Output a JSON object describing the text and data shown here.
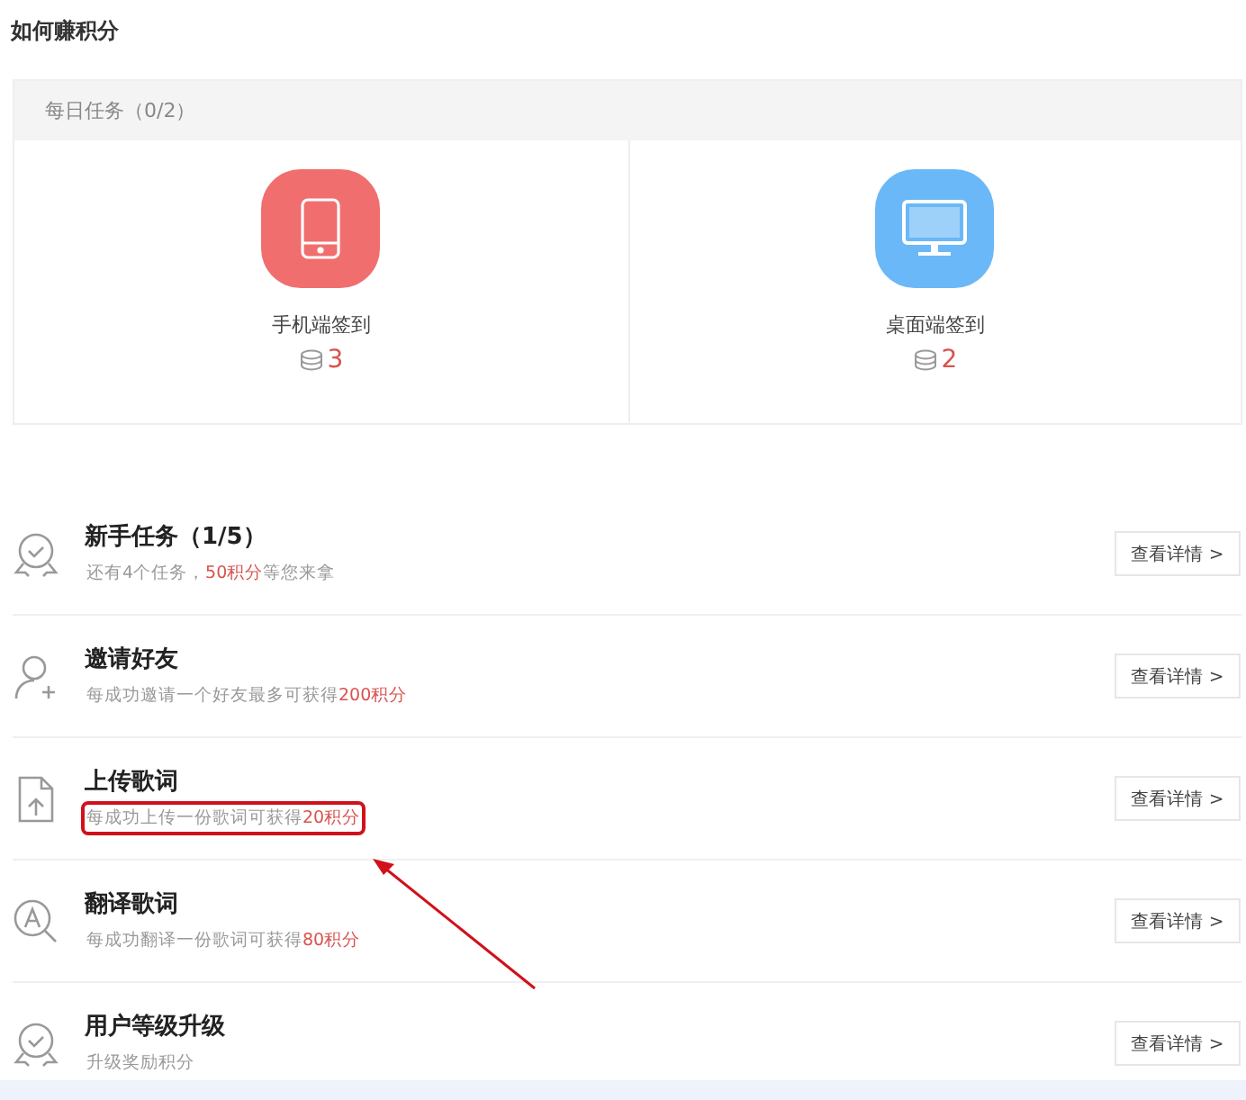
{
  "title": "如何赚积分",
  "daily": {
    "heading": "每日任务（0/2）",
    "tasks": [
      {
        "kind": "phone",
        "label": "手机端签到",
        "points": "3",
        "color": "#f16e6e"
      },
      {
        "kind": "desktop",
        "label": "桌面端签到",
        "points": "2",
        "color": "#6ab8f7"
      }
    ]
  },
  "tasks": [
    {
      "kind": "medal",
      "title": "新手任务（1/5）",
      "subtitle": [
        {
          "text": "还有4个任务，",
          "highlight": false
        },
        {
          "text": "50积分",
          "highlight": true
        },
        {
          "text": "等您来拿",
          "highlight": false
        }
      ],
      "button": "查看详情 >",
      "annotated": false
    },
    {
      "kind": "invite",
      "title": "邀请好友",
      "subtitle": [
        {
          "text": "每成功邀请一个好友最多可获得",
          "highlight": false
        },
        {
          "text": "200积分",
          "highlight": true
        }
      ],
      "button": "查看详情 >",
      "annotated": false
    },
    {
      "kind": "upload",
      "title": "上传歌词",
      "subtitle": [
        {
          "text": "每成功上传一份歌词可获得",
          "highlight": false
        },
        {
          "text": "20积分",
          "highlight": true
        }
      ],
      "button": "查看详情 >",
      "annotated": true
    },
    {
      "kind": "translate",
      "title": "翻译歌词",
      "subtitle": [
        {
          "text": "每成功翻译一份歌词可获得",
          "highlight": false
        },
        {
          "text": "80积分",
          "highlight": true
        }
      ],
      "button": "查看详情 >",
      "annotated": false
    },
    {
      "kind": "medal",
      "title": "用户等级升级",
      "subtitle": [
        {
          "text": "升级奖励积分",
          "highlight": false
        }
      ],
      "button": "查看详情 >",
      "annotated": false
    }
  ]
}
